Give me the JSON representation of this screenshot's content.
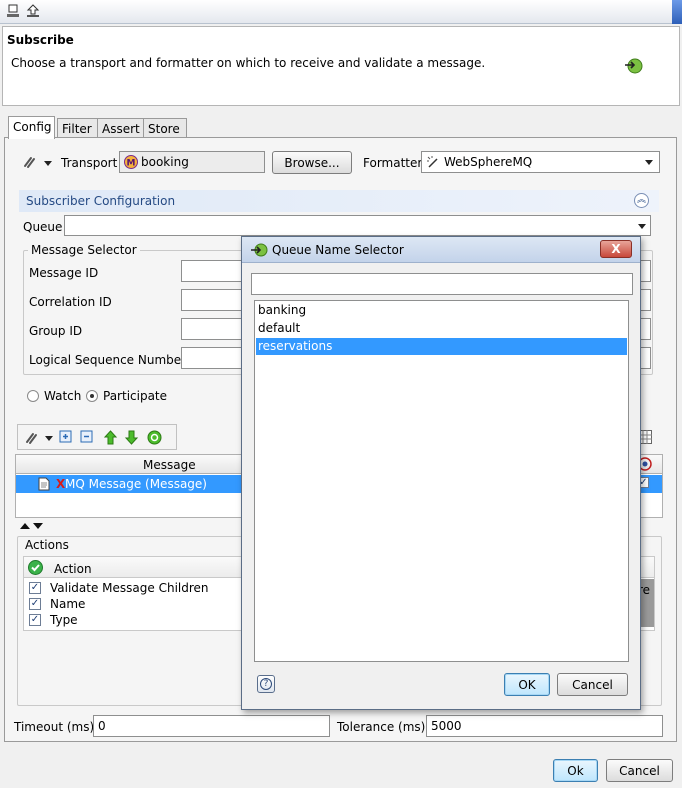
{
  "header": {
    "title": "Subscribe",
    "description": "Choose a transport and formatter on which to receive and validate a message."
  },
  "tabs": [
    {
      "label": "Config",
      "active": true
    },
    {
      "label": "Filter",
      "active": false
    },
    {
      "label": "Assert",
      "active": false
    },
    {
      "label": "Store",
      "active": false
    }
  ],
  "transport": {
    "label": "Transport",
    "value": "booking",
    "browse_label": "Browse..."
  },
  "formatter": {
    "label": "Formatter",
    "value": "WebSphereMQ"
  },
  "subscriber_config": {
    "title": "Subscriber Configuration",
    "queue_label": "Queue",
    "queue_value": ""
  },
  "message_selector": {
    "legend": "Message Selector",
    "fields": [
      {
        "label": "Message ID",
        "value": ""
      },
      {
        "label": "Correlation ID",
        "value": ""
      },
      {
        "label": "Group ID",
        "value": ""
      },
      {
        "label": "Logical Sequence Number",
        "value": ""
      }
    ]
  },
  "mode": {
    "watch_label": "Watch",
    "participate_label": "Participate",
    "selected": "Participate"
  },
  "message_table": {
    "column": "Message",
    "row_prefix": "X",
    "row_label": "MQ Message (Message)"
  },
  "actions": {
    "legend": "Actions",
    "column": "Action",
    "right_column_partial": "re",
    "rows": [
      {
        "label": "Validate Message Children",
        "checked": true
      },
      {
        "label": "Name",
        "checked": true
      },
      {
        "label": "Type",
        "checked": true
      }
    ]
  },
  "timeout": {
    "label": "Timeout (ms)",
    "value": "0"
  },
  "tolerance": {
    "label": "Tolerance (ms)",
    "value": "5000"
  },
  "footer": {
    "ok_label": "Ok",
    "cancel_label": "Cancel"
  },
  "dialog": {
    "title": "Queue Name Selector",
    "filter_value": "",
    "items": [
      "banking",
      "default",
      "reservations"
    ],
    "selected": "reservations",
    "ok_label": "OK",
    "cancel_label": "Cancel",
    "close_glyph": "X",
    "help_glyph": "?"
  },
  "colors": {
    "selection": "#3399ff",
    "section_text": "#254a84",
    "close_button": "#c8483a"
  }
}
